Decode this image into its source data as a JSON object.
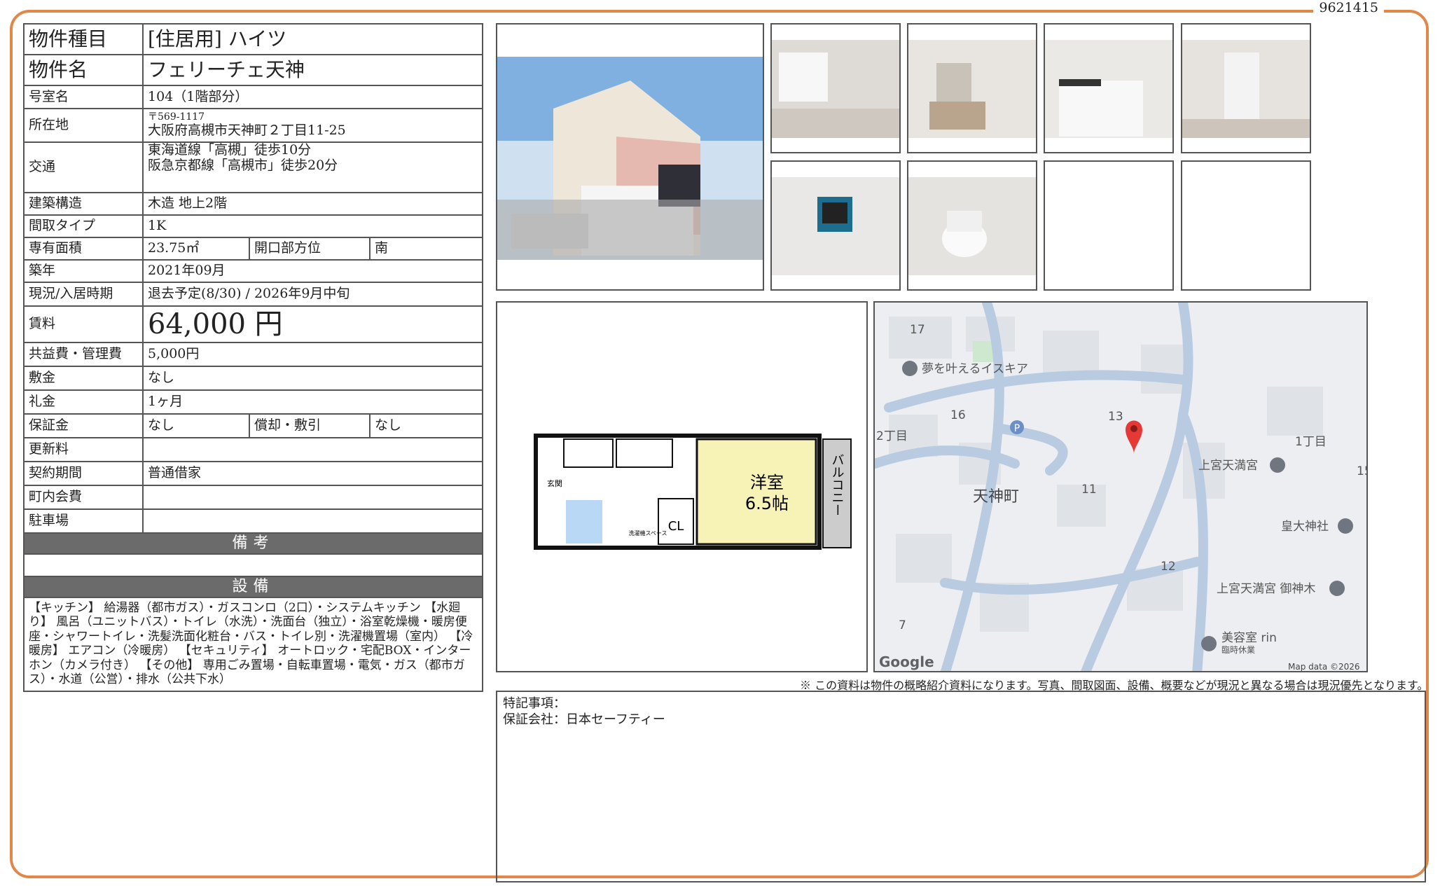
{
  "doc_id": "9621415",
  "property": {
    "type_label": "物件種目",
    "type_value": "[住居用]  ハイツ",
    "name_label": "物件名",
    "name_value": "フェリーチェ天神",
    "room_label": "号室名",
    "room_value": "104（1階部分）",
    "address_label": "所在地",
    "postal": "〒569-1117",
    "address": "大阪府高槻市天神町２丁目11-25",
    "transit_label": "交通",
    "transit_1": "東海道線「高槻」徒歩10分",
    "transit_2": "阪急京都線「高槻市」徒歩20分",
    "structure_label": "建築構造",
    "structure_value": "木造  地上2階",
    "layout_label": "間取タイプ",
    "layout_value": "1K",
    "area_label": "専有面積",
    "area_value": "23.75㎡",
    "facing_label": "開口部方位",
    "facing_value": "南",
    "built_label": "築年",
    "built_value": "2021年09月",
    "status_label": "現況/入居時期",
    "status_value": "退去予定(8/30)  /  2026年9月中旬",
    "rent_label": "賃料",
    "rent_value": "64,000 円",
    "fee_label": "共益費・管理費",
    "fee_value": "5,000円",
    "deposit_label": "敷金",
    "deposit_value": "なし",
    "keymoney_label": "礼金",
    "keymoney_value": "1ヶ月",
    "guarantee_label": "保証金",
    "guarantee_value": "なし",
    "amort_label": "償却・敷引",
    "amort_value": "なし",
    "renewal_label": "更新料",
    "renewal_value": "",
    "contract_label": "契約期間",
    "contract_value": "普通借家",
    "community_label": "町内会費",
    "community_value": "",
    "parking_label": "駐車場",
    "parking_value": "",
    "remarks_head": "備考",
    "remarks_value": "",
    "equipment_head": "設備",
    "equipment_text": "【キッチン】 給湯器（都市ガス）・ガスコンロ（2口）・システムキッチン 【水廻り】 風呂（ユニットバス）・トイレ（水洗）・洗面台（独立）・浴室乾燥機・暖房便座・シャワートイレ・洗髪洗面化粧台・バス・トイレ別・洗濯機置場（室内） 【冷暖房】 エアコン（冷暖房） 【セキュリティ】 オートロック・宅配BOX・インターホン（カメラ付き） 【その他】 専用ごみ置場・自転車置場・電気・ガス（都市ガス）・水道（公営）・排水（公共下水）"
  },
  "floorplan": {
    "room_name": "洋室",
    "room_size": "6.5帖",
    "balcony": "バルコニー",
    "closet": "CL",
    "entrance": "玄関",
    "laundry": "洗濯機スペース"
  },
  "map": {
    "labels": [
      "17",
      "16",
      "13",
      "11",
      "12",
      "7",
      "1丁目",
      "2丁目",
      "15"
    ],
    "town": "天神町",
    "poi_school": "夢を叶えるイスキア",
    "poi_shrine1": "上宮天満宮",
    "poi_shrine2": "皇大神社",
    "poi_shrine3": "上宮天満宮 御神木",
    "poi_salon": "美容室 rin",
    "poi_salon_sub": "臨時休業",
    "parking": "P",
    "brand": "Google",
    "attribution": "Map data ©2026"
  },
  "disclaimer": "※ この資料は物件の概略紹介資料になります。写真、間取図面、設備、概要などが現況と異なる場合は現況優先となります。",
  "special": {
    "heading": "特記事項：",
    "guarantor": "保証会社：日本セーフティー"
  },
  "colors": {
    "frame": "#e0874a",
    "section_head": "#6b6b6b",
    "map_road": "#b9cbe0",
    "room_fill": "#f7f2b6"
  }
}
